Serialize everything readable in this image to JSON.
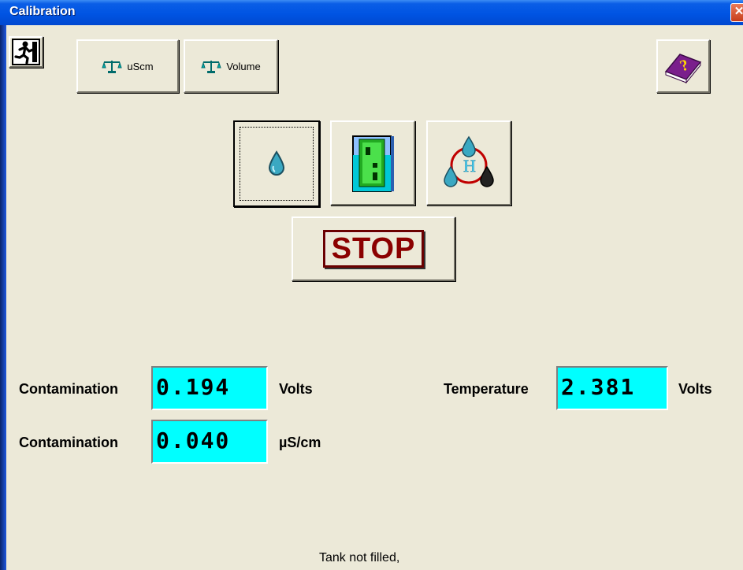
{
  "window": {
    "title": "Calibration",
    "close_glyph": "✕"
  },
  "toolbar": {
    "exit_icon": "exit-running-man-icon",
    "uscm_label": "uScm",
    "volume_label": "Volume",
    "scale_icon": "balance-scale-icon",
    "help_icon": "help-book-icon"
  },
  "actions": {
    "drop_icon": "water-drop-icon",
    "tank_icon": "tank-level-icon",
    "hydrogen_icon": "hydrogen-drops-icon",
    "stop_label": "STOP"
  },
  "readings": {
    "contamination_volts": {
      "label": "Contamination",
      "value": "0.194",
      "unit": "Volts"
    },
    "contamination_us": {
      "label": "Contamination",
      "value": "0.040",
      "unit": "µS/cm"
    },
    "temperature_volts": {
      "label": "Temperature",
      "value": "2.381",
      "unit": "Volts"
    }
  },
  "colors": {
    "lcd_bg": "#00ffff",
    "stop_text": "#8b0000",
    "titlebar": "#0054e3"
  },
  "status": {
    "message": "Tank not filled,"
  }
}
